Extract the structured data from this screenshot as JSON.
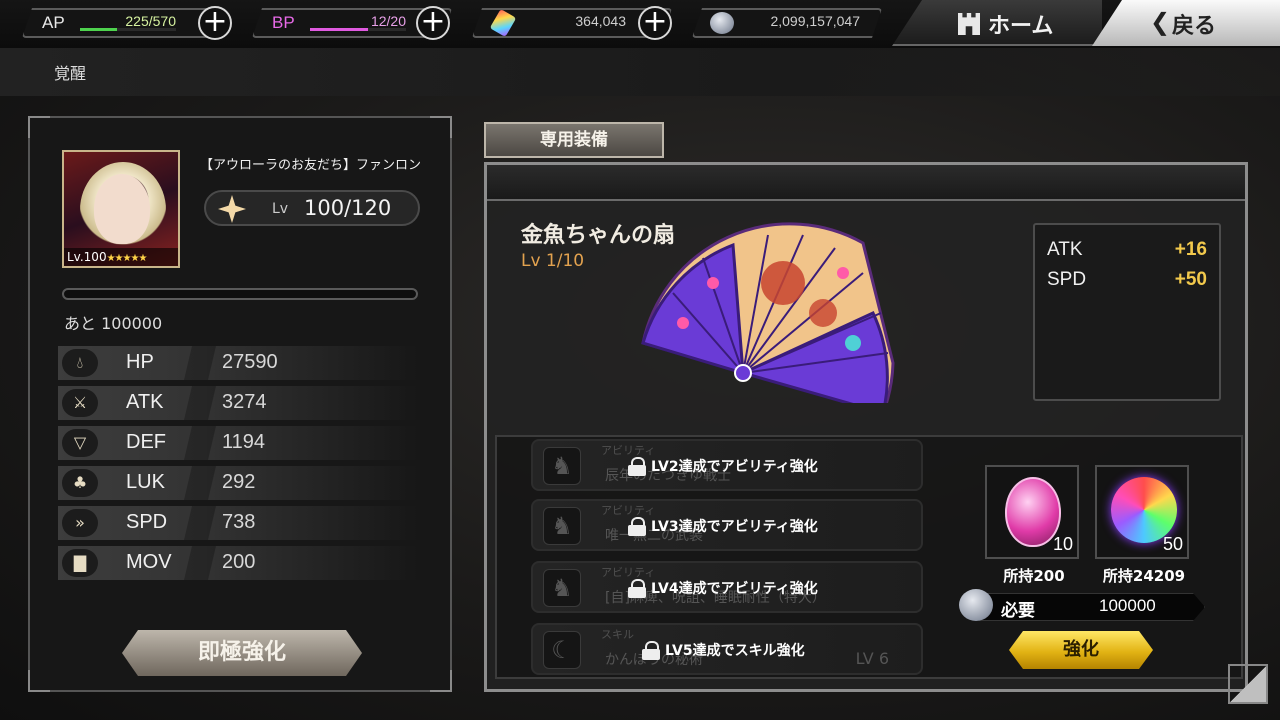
{
  "topbar": {
    "ap": {
      "label": "AP",
      "value": "225/570",
      "fraction": 0.39,
      "bar_color": "#4ed34e"
    },
    "bp": {
      "label": "BP",
      "value": "12/20",
      "fraction": 0.6,
      "bar_color": "#e05ae0"
    },
    "gems": {
      "value": "364,043",
      "icon": "rainbow-crystal-icon"
    },
    "coins": {
      "value": "2,099,157,047",
      "icon": "silver-coin-icon"
    },
    "home_label": "ホーム",
    "back_label": "戻る"
  },
  "page_title": "覚醒",
  "character": {
    "name": "【アウローラのお友だち】ファンロン",
    "portrait_level": "Lv.100",
    "portrait_stars": "★★★★★",
    "lv_label": "Lv",
    "lv_value": "100/120",
    "remaining": "あと 100000",
    "exp_fraction": 0
  },
  "stats": [
    {
      "name": "HP",
      "value": "27590",
      "icon": "drop-icon"
    },
    {
      "name": "ATK",
      "value": "3274",
      "icon": "sword-icon"
    },
    {
      "name": "DEF",
      "value": "1194",
      "icon": "shield-icon"
    },
    {
      "name": "LUK",
      "value": "292",
      "icon": "clover-icon"
    },
    {
      "name": "SPD",
      "value": "738",
      "icon": "speed-icon"
    },
    {
      "name": "MOV",
      "value": "200",
      "icon": "boot-icon"
    }
  ],
  "max_enhance_label": "即極強化",
  "equipment": {
    "tab_label": "専用装備",
    "name": "金魚ちゃんの扇",
    "level": "Lv 1/10",
    "bonuses": [
      {
        "stat": "ATK",
        "value": "+16"
      },
      {
        "stat": "SPD",
        "value": "+50"
      }
    ]
  },
  "abilities": [
    {
      "category": "アビリティ",
      "name": "辰年のたつきゆ戦士",
      "lock_text": "LV2達成でアビリティ強化",
      "level": ""
    },
    {
      "category": "アビリティ",
      "name": "唯一無二の武装",
      "lock_text": "LV3達成でアビリティ強化",
      "level": ""
    },
    {
      "category": "アビリティ",
      "name": "[自]麻痺、呪詛、睡眠耐性（特大）",
      "lock_text": "LV4達成でアビリティ強化",
      "level": ""
    },
    {
      "category": "スキル",
      "name": "かんぽうの秘術",
      "lock_text": "LV5達成でスキル強化",
      "level": "LV 6"
    }
  ],
  "materials": [
    {
      "count": "10",
      "owned": "所持200",
      "icon": "pink-egg-icon"
    },
    {
      "count": "50",
      "owned": "所持24209",
      "icon": "rainbow-orb-icon"
    }
  ],
  "cost": {
    "label": "必要",
    "value": "100000"
  },
  "enhance_label": "強化"
}
